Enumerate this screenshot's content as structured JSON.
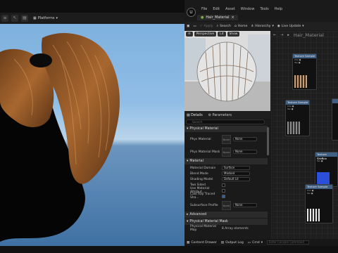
{
  "viewport": {
    "platforms_label": "Platforms"
  },
  "editor": {
    "logo": "U",
    "menu": [
      "File",
      "Edit",
      "Asset",
      "Window",
      "Tools",
      "Help"
    ],
    "tab_title": "Hair_Material",
    "toolbar": {
      "apply": "Apply",
      "search": "Search",
      "home": "Home",
      "hierarchy": "Hierarchy",
      "live_update": "Live Update"
    },
    "preview": {
      "perspective": "Perspective",
      "lit": "Lit",
      "show": "Show"
    },
    "details": {
      "tab_details": "Details",
      "tab_parameters": "Parameters",
      "search_placeholder": "Search",
      "categories": {
        "physical_material": "Physical Material",
        "material": "Material",
        "advanced": "Advanced",
        "physical_material_mask": "Physical Material Mask"
      },
      "rows": {
        "phys_material": "Phys Material",
        "phys_material_mask": "Phys Material Mask",
        "material_domain": "Material Domain",
        "blend_mode": "Blend Mode",
        "shading_model": "Shading Model",
        "two_sided": "Two Sided",
        "use_material_attributes": "Use Material Attribut...",
        "cast_ray_traced_shadows": "Cast Ray Traced Sha...",
        "subsurface_profile": "Subsurface Profile",
        "physical_material_map": "Physical Material Map"
      },
      "values": {
        "none": "None",
        "slot_none": "None",
        "material_domain": "Surface",
        "blend_mode": "Masked",
        "shading_model": "Default Lit",
        "physical_material_map_value": "8 Array elements"
      }
    },
    "graph": {
      "title": "Hair_Material",
      "node_title": "Texture Sample"
    },
    "statusbar": {
      "content_drawer": "Content Drawer",
      "output_log": "Output Log",
      "cmd": "Cmd",
      "cmd_placeholder": "Enter Console Command"
    }
  }
}
